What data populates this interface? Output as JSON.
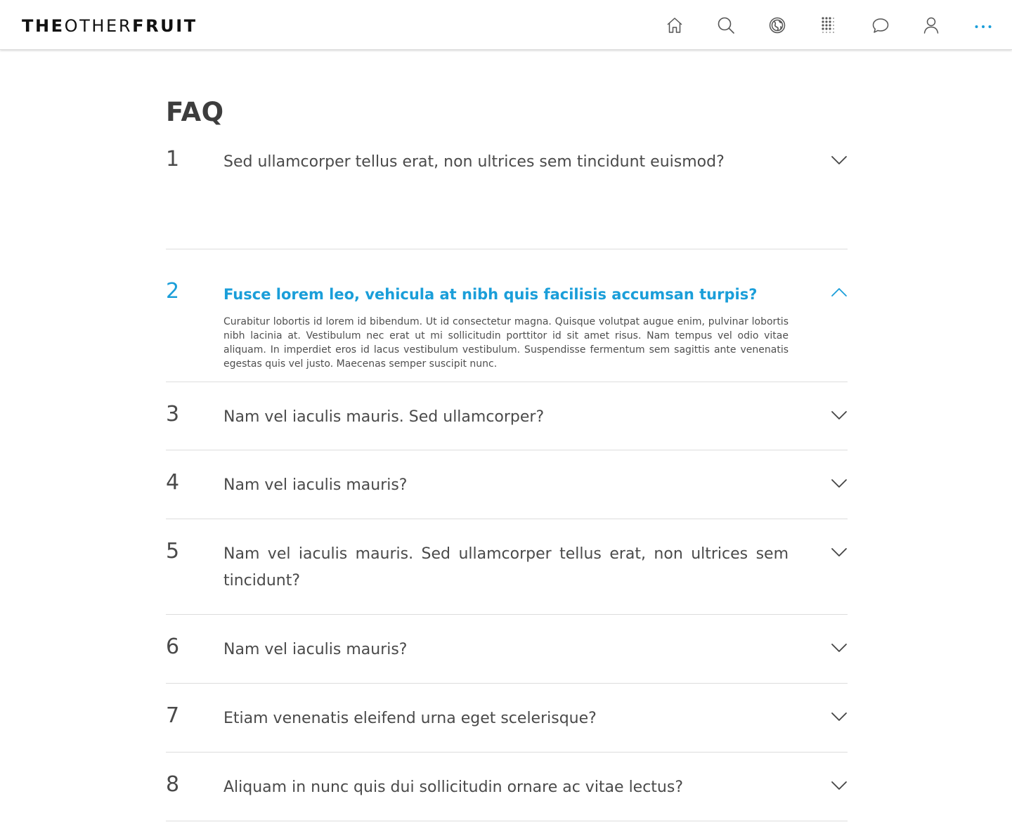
{
  "brand": {
    "logo_part1": "THE",
    "logo_part2": "OTHER",
    "logo_part3": "FRUIT"
  },
  "nav": {
    "icons": [
      "home-icon",
      "search-icon",
      "globe-icon",
      "apps-grid-icon",
      "chat-icon",
      "user-icon",
      "more-icon"
    ],
    "accent_color": "#1a9ed9"
  },
  "page": {
    "title": "FAQ"
  },
  "faq": [
    {
      "num": "1",
      "question": "Sed ullamcorper tellus erat, non ultrices sem tincidunt euismod?",
      "open": false
    },
    {
      "num": "2",
      "question": "Fusce lorem leo, vehicula at nibh quis facilisis accumsan turpis?",
      "open": true,
      "answer": "Curabitur lobortis id lorem id bibendum. Ut id consectetur magna. Quisque volutpat augue enim, pulvinar lobortis nibh lacinia at. Vestibulum nec erat ut mi sollicitudin porttitor id sit amet risus. Nam tempus vel odio vitae aliquam. In imperdiet eros id lacus vestibulum vestibulum. Suspendisse fermentum sem sagittis ante venenatis egestas quis vel justo. Maecenas semper suscipit nunc."
    },
    {
      "num": "3",
      "question": "Nam vel iaculis mauris. Sed ullamcorper?",
      "open": false
    },
    {
      "num": "4",
      "question": "Nam vel iaculis mauris?",
      "open": false
    },
    {
      "num": "5",
      "question": "Nam vel iaculis mauris. Sed ullamcorper tellus erat, non ultrices sem tincidunt?",
      "open": false
    },
    {
      "num": "6",
      "question": "Nam vel iaculis mauris?",
      "open": false
    },
    {
      "num": "7",
      "question": "Etiam venenatis eleifend urna eget scelerisque?",
      "open": false
    },
    {
      "num": "8",
      "question": "Aliquam in nunc quis dui sollicitudin ornare ac vitae lectus?",
      "open": false
    }
  ]
}
